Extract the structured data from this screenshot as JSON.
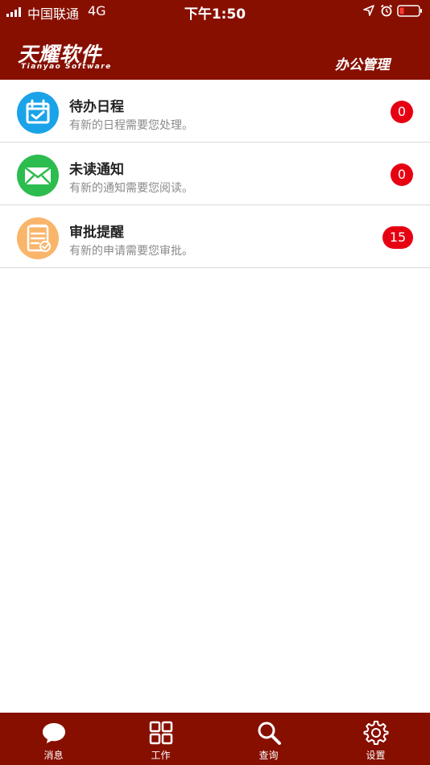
{
  "status_bar": {
    "carrier": "中国联通",
    "network": "4G",
    "time": "下午1:50"
  },
  "header": {
    "logo_text": "天耀软件",
    "logo_subtext": "Tianyao Software",
    "title": "办公管理"
  },
  "colors": {
    "brand": "#870f00",
    "badge": "#e60012",
    "schedule_icon": "#1aa3e8",
    "notice_icon": "#2dbc4e",
    "approval_icon": "#f9b56a"
  },
  "list": {
    "items": [
      {
        "title": "待办日程",
        "subtitle": "有新的日程需要您处理。",
        "count": "0",
        "icon": "calendar-check-icon"
      },
      {
        "title": "未读通知",
        "subtitle": "有新的通知需要您阅读。",
        "count": "0",
        "icon": "envelope-icon"
      },
      {
        "title": "审批提醒",
        "subtitle": "有新的申请需要您审批。",
        "count": "15",
        "icon": "document-check-icon"
      }
    ]
  },
  "tabs": [
    {
      "label": "消息",
      "icon": "chat-bubble-icon"
    },
    {
      "label": "工作",
      "icon": "grid-icon"
    },
    {
      "label": "查询",
      "icon": "search-icon"
    },
    {
      "label": "设置",
      "icon": "gear-icon"
    }
  ]
}
